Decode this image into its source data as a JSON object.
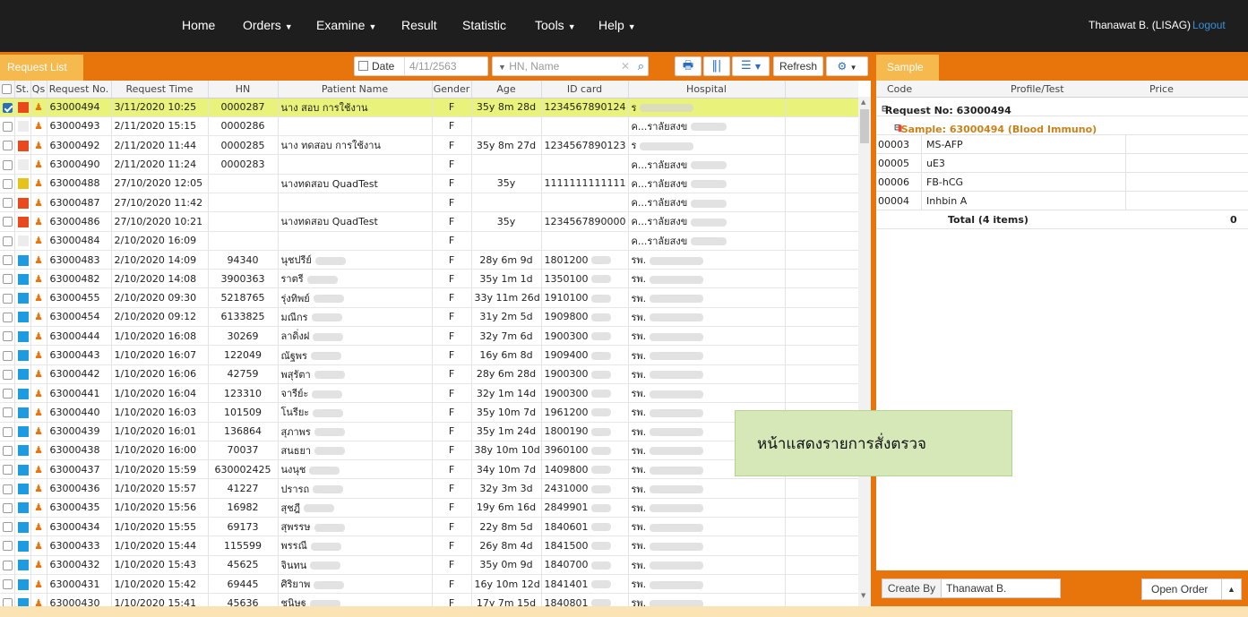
{
  "nav": {
    "items": [
      {
        "label": "Home",
        "caret": false
      },
      {
        "label": "Orders",
        "caret": true
      },
      {
        "label": "Examine",
        "caret": true
      },
      {
        "label": "Result",
        "caret": false
      },
      {
        "label": "Statistic",
        "caret": false
      },
      {
        "label": "Tools",
        "caret": true
      },
      {
        "label": "Help",
        "caret": true
      }
    ],
    "user": "Thanawat B. (LISAG)",
    "logout": "Logout"
  },
  "toolbar": {
    "tab_label": "Request List",
    "date_label": "Date",
    "date_value": "4/11/2563",
    "search_placeholder": "HN, Name",
    "refresh_label": "Refresh"
  },
  "grid": {
    "headers": [
      "St.",
      "Qs",
      "Request No.",
      "Request Time",
      "HN",
      "Patient Name",
      "Gender",
      "Age",
      "ID card",
      "Hospital"
    ],
    "rows": [
      {
        "checked": true,
        "status": "#e8491d",
        "req": "63000494",
        "time": "3/11/2020 10:25",
        "hn": "0000287",
        "name": "นาง สอบ การใช้งาน",
        "gender": "F",
        "age": "35y 8m 28d",
        "id": "1234567890124",
        "hosp": "ร"
      },
      {
        "checked": false,
        "status": "#ececec",
        "req": "63000493",
        "time": "2/11/2020 15:15",
        "hn": "0000286",
        "name": "",
        "gender": "F",
        "age": "",
        "id": "",
        "hosp": "ค...ราลัยสงข"
      },
      {
        "checked": false,
        "status": "#e8491d",
        "req": "63000492",
        "time": "2/11/2020 11:44",
        "hn": "0000285",
        "name": "นาง ทดสอบ การใช้งาน",
        "gender": "F",
        "age": "35y 8m 27d",
        "id": "1234567890123",
        "hosp": "ร"
      },
      {
        "checked": false,
        "status": "#ececec",
        "req": "63000490",
        "time": "2/11/2020 11:24",
        "hn": "0000283",
        "name": "",
        "gender": "F",
        "age": "",
        "id": "",
        "hosp": "ค...ราลัยสงข"
      },
      {
        "checked": false,
        "status": "#e6c31b",
        "req": "63000488",
        "time": "27/10/2020 12:05",
        "hn": "",
        "name": "นางทดสอบ QuadTest",
        "gender": "F",
        "age": "35y",
        "id": "1111111111111",
        "hosp": "ค...ราลัยสงข"
      },
      {
        "checked": false,
        "status": "#e8491d",
        "req": "63000487",
        "time": "27/10/2020 11:42",
        "hn": "",
        "name": "",
        "gender": "F",
        "age": "",
        "id": "",
        "hosp": "ค...ราลัยสงข"
      },
      {
        "checked": false,
        "status": "#e8491d",
        "req": "63000486",
        "time": "27/10/2020 10:21",
        "hn": "",
        "name": "นางทดสอบ QuadTest",
        "gender": "F",
        "age": "35y",
        "id": "1234567890000",
        "hosp": "ค...ราลัยสงข"
      },
      {
        "checked": false,
        "status": "#ececec",
        "req": "63000484",
        "time": "2/10/2020 16:09",
        "hn": "",
        "name": "",
        "gender": "F",
        "age": "",
        "id": "",
        "hosp": "ค...ราลัยสงข"
      },
      {
        "checked": false,
        "status": "#1d9be0",
        "req": "63000483",
        "time": "2/10/2020 14:09",
        "hn": "94340",
        "name": "นุชปรีย์",
        "gender": "F",
        "age": "28y 6m 9d",
        "id": "1801200",
        "hosp": "รพ."
      },
      {
        "checked": false,
        "status": "#1d9be0",
        "req": "63000482",
        "time": "2/10/2020 14:08",
        "hn": "3900363",
        "name": "ราตรี",
        "gender": "F",
        "age": "35y 1m 1d",
        "id": "1350100",
        "hosp": "รพ."
      },
      {
        "checked": false,
        "status": "#1d9be0",
        "req": "63000455",
        "time": "2/10/2020 09:30",
        "hn": "5218765",
        "name": "รุ่งทิพย์",
        "gender": "F",
        "age": "33y 11m 26d",
        "id": "1910100",
        "hosp": "รพ."
      },
      {
        "checked": false,
        "status": "#1d9be0",
        "req": "63000454",
        "time": "2/10/2020 09:12",
        "hn": "6133825",
        "name": "มณีกร",
        "gender": "F",
        "age": "31y 2m 5d",
        "id": "1909800",
        "hosp": "รพ."
      },
      {
        "checked": false,
        "status": "#1d9be0",
        "req": "63000444",
        "time": "1/10/2020 16:08",
        "hn": "30269",
        "name": "ลาดิ่งฝ",
        "gender": "F",
        "age": "32y 7m 6d",
        "id": "1900300",
        "hosp": "รพ."
      },
      {
        "checked": false,
        "status": "#1d9be0",
        "req": "63000443",
        "time": "1/10/2020 16:07",
        "hn": "122049",
        "name": "ณัฐพร",
        "gender": "F",
        "age": "16y 6m 8d",
        "id": "1909400",
        "hosp": "รพ."
      },
      {
        "checked": false,
        "status": "#1d9be0",
        "req": "63000442",
        "time": "1/10/2020 16:06",
        "hn": "42759",
        "name": "พสุรัตา",
        "gender": "F",
        "age": "28y 6m 28d",
        "id": "1900300",
        "hosp": "รพ."
      },
      {
        "checked": false,
        "status": "#1d9be0",
        "req": "63000441",
        "time": "1/10/2020 16:04",
        "hn": "123310",
        "name": "จารีย์ะ",
        "gender": "F",
        "age": "32y 1m 14d",
        "id": "1900300",
        "hosp": "รพ."
      },
      {
        "checked": false,
        "status": "#1d9be0",
        "req": "63000440",
        "time": "1/10/2020 16:03",
        "hn": "101509",
        "name": "โนรียะ",
        "gender": "F",
        "age": "35y 10m 7d",
        "id": "1961200",
        "hosp": "รพ."
      },
      {
        "checked": false,
        "status": "#1d9be0",
        "req": "63000439",
        "time": "1/10/2020 16:01",
        "hn": "136864",
        "name": "สุภาพร",
        "gender": "F",
        "age": "35y 1m 24d",
        "id": "1800190",
        "hosp": "รพ."
      },
      {
        "checked": false,
        "status": "#1d9be0",
        "req": "63000438",
        "time": "1/10/2020 16:00",
        "hn": "70037",
        "name": "สนธยา",
        "gender": "F",
        "age": "38y 10m 10d",
        "id": "3960100",
        "hosp": "รพ."
      },
      {
        "checked": false,
        "status": "#1d9be0",
        "req": "63000437",
        "time": "1/10/2020 15:59",
        "hn": "630002425",
        "name": "นงนุช",
        "gender": "F",
        "age": "34y 10m 7d",
        "id": "1409800",
        "hosp": "รพ."
      },
      {
        "checked": false,
        "status": "#1d9be0",
        "req": "63000436",
        "time": "1/10/2020 15:57",
        "hn": "41227",
        "name": "ปรารถ",
        "gender": "F",
        "age": "32y 3m 3d",
        "id": "2431000",
        "hosp": "รพ."
      },
      {
        "checked": false,
        "status": "#1d9be0",
        "req": "63000435",
        "time": "1/10/2020 15:56",
        "hn": "16982",
        "name": "สุชฎี",
        "gender": "F",
        "age": "19y 6m 16d",
        "id": "2849901",
        "hosp": "รพ."
      },
      {
        "checked": false,
        "status": "#1d9be0",
        "req": "63000434",
        "time": "1/10/2020 15:55",
        "hn": "69173",
        "name": "สุพรรษ",
        "gender": "F",
        "age": "22y 8m 5d",
        "id": "1840601",
        "hosp": "รพ."
      },
      {
        "checked": false,
        "status": "#1d9be0",
        "req": "63000433",
        "time": "1/10/2020 15:44",
        "hn": "115599",
        "name": "พรรณี",
        "gender": "F",
        "age": "26y 8m 4d",
        "id": "1841500",
        "hosp": "รพ."
      },
      {
        "checked": false,
        "status": "#1d9be0",
        "req": "63000432",
        "time": "1/10/2020 15:43",
        "hn": "45625",
        "name": "จินทน",
        "gender": "F",
        "age": "35y 0m 9d",
        "id": "1840700",
        "hosp": "รพ."
      },
      {
        "checked": false,
        "status": "#1d9be0",
        "req": "63000431",
        "time": "1/10/2020 15:42",
        "hn": "69445",
        "name": "ศิริยาพ",
        "gender": "F",
        "age": "16y 10m 12d",
        "id": "1841401",
        "hosp": "รพ."
      },
      {
        "checked": false,
        "status": "#1d9be0",
        "req": "63000430",
        "time": "1/10/2020 15:41",
        "hn": "45636",
        "name": "ชนิษฐ",
        "gender": "F",
        "age": "17y 7m 15d",
        "id": "1840801",
        "hosp": "รพ."
      }
    ]
  },
  "sample": {
    "tab_label": "Sample",
    "headers": [
      "Code",
      "Profile/Test",
      "Price"
    ],
    "request_label": "Request No: 63000494",
    "sample_label": "Sample: 63000494  (Blood Immuno)",
    "tests": [
      {
        "code": "00003",
        "name": "MS-AFP"
      },
      {
        "code": "00005",
        "name": "uE3"
      },
      {
        "code": "00006",
        "name": "FB-hCG"
      },
      {
        "code": "00004",
        "name": "Inhbin A"
      }
    ],
    "total_label": "Total  (4 items)",
    "total_value": "0",
    "create_by_label": "Create By",
    "create_by_value": "Thanawat B.",
    "open_order_label": "Open Order"
  },
  "annotation": "หน้าแสดงรายการสั่งตรวจ",
  "colors": {
    "accent": "#e8750c",
    "tab": "#f6b94d",
    "selected_row": "#e9f27a",
    "nav_bg": "#1e1e1e"
  }
}
